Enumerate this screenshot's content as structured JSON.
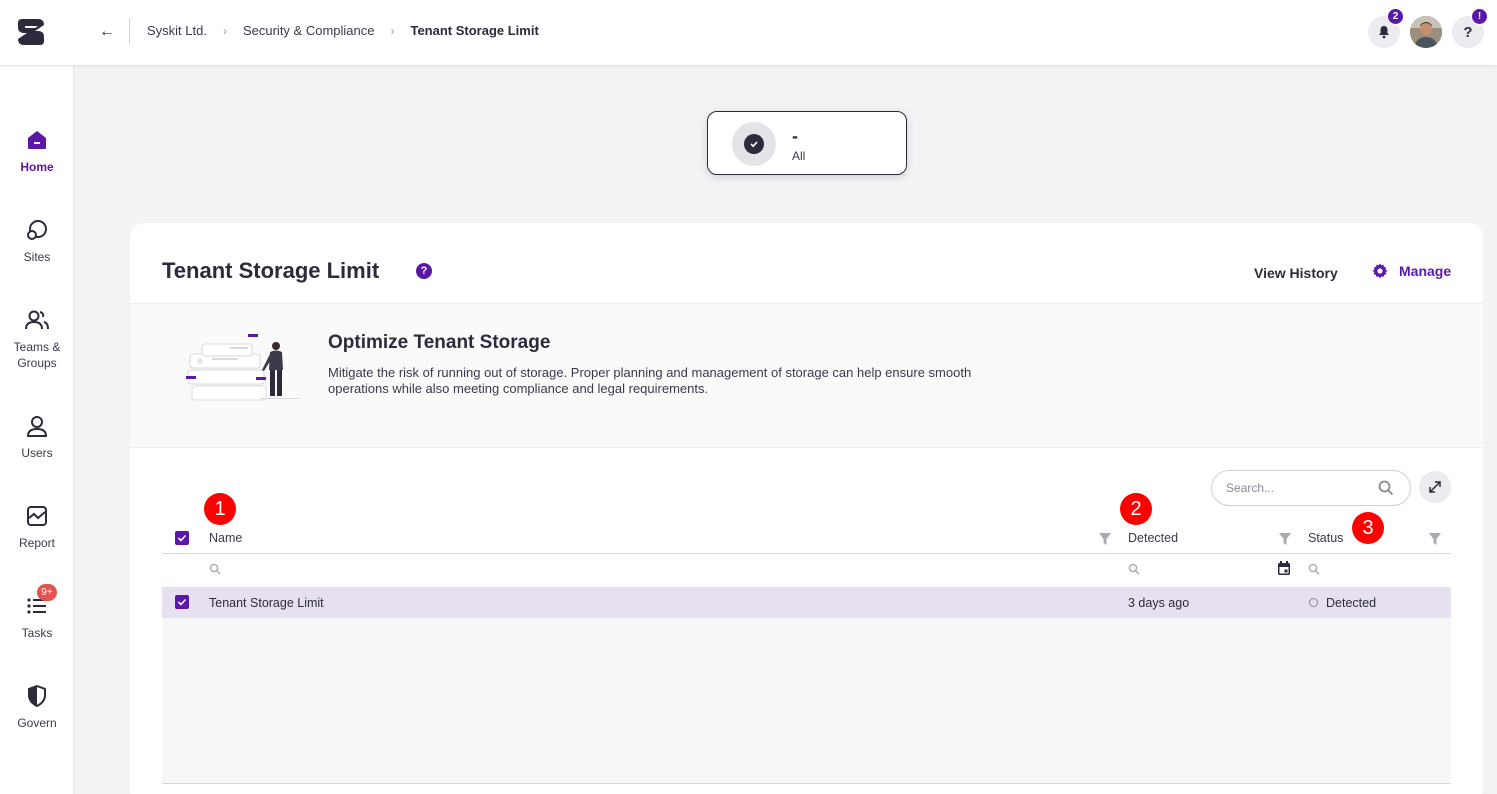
{
  "topbar": {
    "breadcrumbs": [
      "Syskit Ltd.",
      "Security & Compliance",
      "Tenant Storage Limit"
    ],
    "notifications_count": "2",
    "help_badge": "!"
  },
  "sidebar": {
    "items": [
      {
        "label": "Home",
        "icon": "home-icon",
        "active": true
      },
      {
        "label": "Sites",
        "icon": "sites-icon"
      },
      {
        "label": "Teams & Groups",
        "icon": "teams-icon"
      },
      {
        "label": "Users",
        "icon": "user-icon"
      },
      {
        "label": "Report",
        "icon": "report-icon"
      },
      {
        "label": "Tasks",
        "icon": "tasks-icon",
        "badge": "9+"
      },
      {
        "label": "Govern",
        "icon": "shield-icon"
      }
    ]
  },
  "summary": {
    "value": "-",
    "label": "All"
  },
  "panel": {
    "title": "Tenant Storage Limit",
    "view_history": "View History",
    "manage": "Manage",
    "info_title": "Optimize Tenant Storage",
    "info_desc": "Mitigate the risk of running out of storage. Proper planning and management of storage can help ensure smooth operations while also meeting compliance and legal requirements."
  },
  "table": {
    "search_placeholder": "Search...",
    "columns": [
      "Name",
      "Detected",
      "Status"
    ],
    "rows": [
      {
        "name": "Tenant Storage Limit",
        "detected": "3 days ago",
        "status": "Detected",
        "selected": true
      }
    ]
  },
  "annotations": [
    "1",
    "2",
    "3"
  ],
  "colors": {
    "accent": "#5a17a8",
    "row_selected": "#e7e0ef",
    "marker": "#ff0000"
  }
}
